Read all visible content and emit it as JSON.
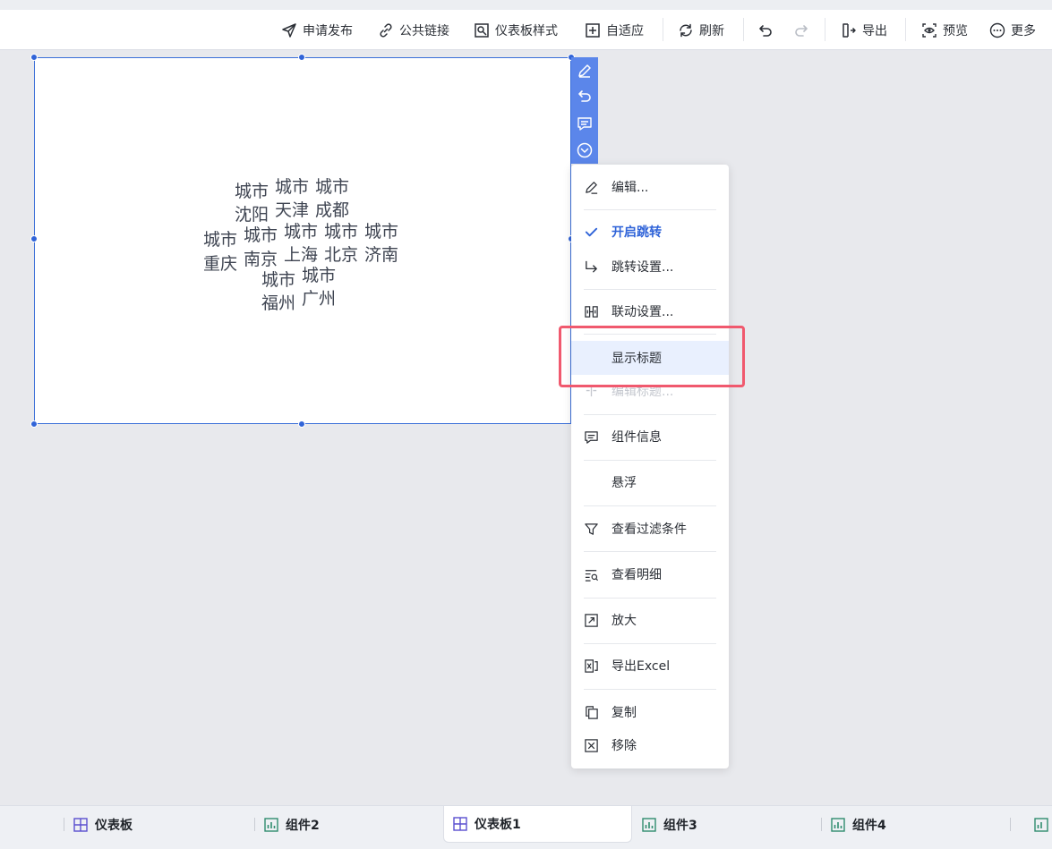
{
  "toolbar": {
    "items": [
      {
        "label": "申请发布",
        "icon": "send-icon"
      },
      {
        "label": "公共链接",
        "icon": "link-icon"
      },
      {
        "label": "仪表板样式",
        "icon": "style-icon"
      },
      {
        "label": "自适应",
        "icon": "adaptive-icon"
      },
      {
        "label": "刷新",
        "icon": "refresh-icon"
      },
      {
        "label": "",
        "icon": "undo-icon"
      },
      {
        "label": "",
        "icon": "redo-icon"
      },
      {
        "label": "导出",
        "icon": "export-icon"
      },
      {
        "label": "预览",
        "icon": "preview-icon"
      },
      {
        "label": "更多",
        "icon": "more-icon"
      }
    ]
  },
  "widget": {
    "type": "word-cloud",
    "words": [
      {
        "label": "城市",
        "value": "沈阳"
      },
      {
        "label": "城市",
        "value": "天津"
      },
      {
        "label": "城市",
        "value": "成都"
      },
      {
        "label": "城市",
        "value": "重庆"
      },
      {
        "label": "城市",
        "value": "南京"
      },
      {
        "label": "城市",
        "value": "上海"
      },
      {
        "label": "城市",
        "value": "北京"
      },
      {
        "label": "城市",
        "value": "济南"
      },
      {
        "label": "城市",
        "value": "福州"
      },
      {
        "label": "城市",
        "value": "广州"
      }
    ],
    "side_actions": [
      "edit-icon",
      "undo-icon",
      "comment-icon",
      "dropdown-icon"
    ]
  },
  "context_menu": {
    "items": [
      {
        "label": "编辑...",
        "icon": "edit-icon"
      },
      {
        "label": "开启跳转",
        "icon": "check-icon",
        "checked": true
      },
      {
        "label": "跳转设置...",
        "icon": "jump-arrow-icon"
      },
      {
        "label": "联动设置...",
        "icon": "link-settings-icon"
      },
      {
        "label": "显示标题",
        "icon": "",
        "highlighted": true
      },
      {
        "label": "编辑标题...",
        "icon": "title-icon",
        "disabled": true
      },
      {
        "label": "组件信息",
        "icon": "info-icon"
      },
      {
        "label": "悬浮",
        "icon": ""
      },
      {
        "label": "查看过滤条件",
        "icon": "filter-icon"
      },
      {
        "label": "查看明细",
        "icon": "detail-icon"
      },
      {
        "label": "放大",
        "icon": "zoom-icon"
      },
      {
        "label": "导出Excel",
        "icon": "excel-icon"
      },
      {
        "label": "复制",
        "icon": "copy-icon"
      },
      {
        "label": "移除",
        "icon": "remove-icon"
      }
    ]
  },
  "tabs": [
    {
      "label": "仪表板",
      "icon": "dashboard-icon",
      "active": false
    },
    {
      "label": "组件2",
      "icon": "component-icon",
      "active": false
    },
    {
      "label": "仪表板1",
      "icon": "dashboard-icon",
      "active": true
    },
    {
      "label": "组件3",
      "icon": "component-icon",
      "active": false
    },
    {
      "label": "组件4",
      "icon": "component-icon",
      "active": false
    }
  ],
  "colors": {
    "accent": "#2f63d8",
    "selection_border": "#3b6fd8",
    "side_strip": "#5b86ea",
    "menu_highlight": "#e9f0fe",
    "annotation": "#f0596e"
  }
}
